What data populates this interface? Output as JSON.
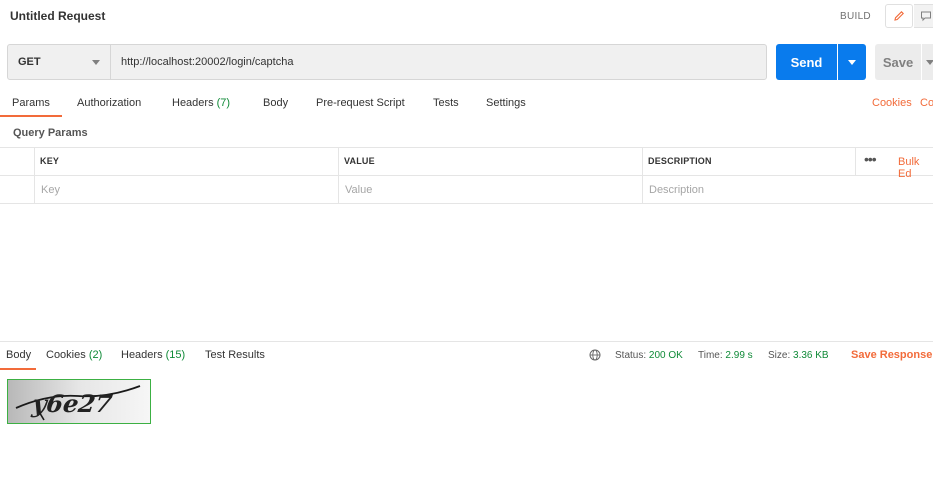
{
  "header": {
    "title": "Untitled Request",
    "build_label": "BUILD"
  },
  "request": {
    "method": "GET",
    "url": "http://localhost:20002/login/captcha",
    "send_label": "Send",
    "save_label": "Save"
  },
  "request_tabs": [
    {
      "label": "Params",
      "count": "",
      "active": true
    },
    {
      "label": "Authorization",
      "count": ""
    },
    {
      "label": "Headers",
      "count": "(7)"
    },
    {
      "label": "Body",
      "count": ""
    },
    {
      "label": "Pre-request Script",
      "count": ""
    },
    {
      "label": "Tests",
      "count": ""
    },
    {
      "label": "Settings",
      "count": ""
    }
  ],
  "request_links": {
    "cookies": "Cookies",
    "code": "Co"
  },
  "query_params": {
    "title": "Query Params",
    "columns": [
      "KEY",
      "VALUE",
      "DESCRIPTION"
    ],
    "bulk_edit": "Bulk Ed",
    "placeholders": {
      "key": "Key",
      "value": "Value",
      "description": "Description"
    }
  },
  "response": {
    "tabs": [
      {
        "label": "Body",
        "count": "",
        "active": true
      },
      {
        "label": "Cookies",
        "count": "(2)"
      },
      {
        "label": "Headers",
        "count": "(15)"
      },
      {
        "label": "Test Results",
        "count": ""
      }
    ],
    "status_label": "Status:",
    "status_value": "200 OK",
    "time_label": "Time:",
    "time_value": "2.99 s",
    "size_label": "Size:",
    "size_value": "3.36 KB",
    "save_response": "Save Response",
    "captcha_text": "y6e27"
  },
  "colors": {
    "accent": "#f26b3a",
    "send_button": "#097bed",
    "success": "#0f8a37"
  },
  "icons": [
    "pencil-icon",
    "comment-icon",
    "globe-icon",
    "chevron-down-icon",
    "more-dots-icon"
  ]
}
